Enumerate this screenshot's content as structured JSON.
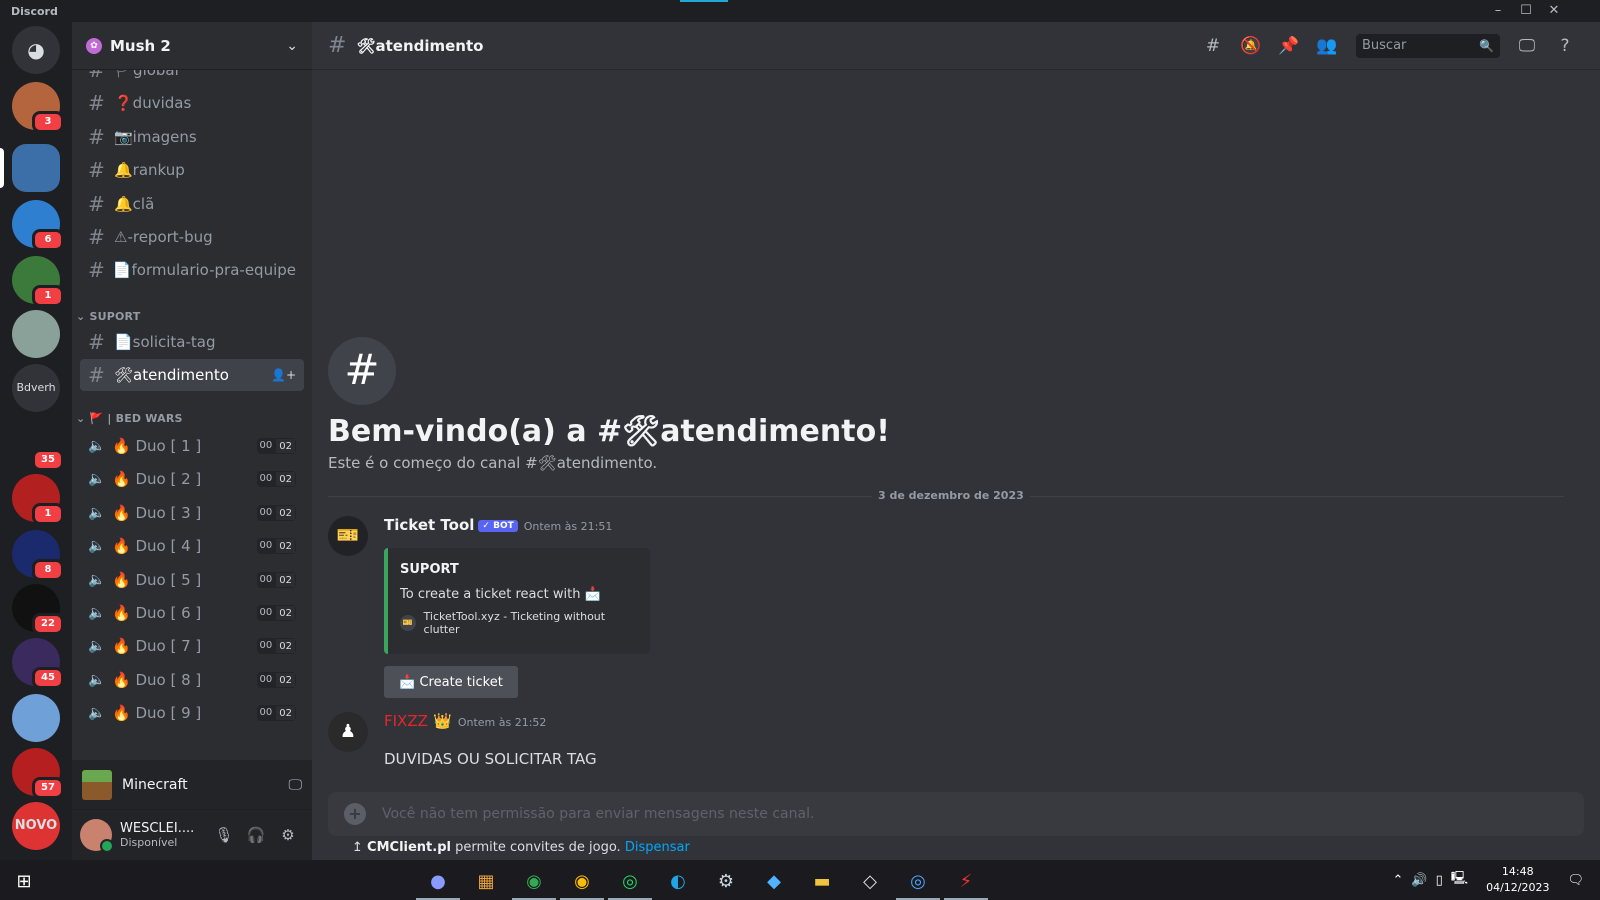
{
  "window": {
    "app_name": "Discord",
    "minimize": "–",
    "maximize": "☐",
    "close": "✕"
  },
  "servers": [
    {
      "name": "direct-messages",
      "badge": "",
      "initials": "",
      "color": "#313338"
    },
    {
      "name": "server-1",
      "badge": "3",
      "color": "#b5653e"
    },
    {
      "name": "mush",
      "badge": "",
      "color": "#3c6fa8",
      "active": true
    },
    {
      "name": "server-3",
      "badge": "6",
      "color": "#2f7fd0"
    },
    {
      "name": "server-4",
      "badge": "1",
      "color": "#3c7a3c"
    },
    {
      "name": "server-5",
      "badge": "",
      "color": "#8aa19a"
    },
    {
      "name": "bdverh",
      "badge": "",
      "initials": "Bdverh",
      "color": "#313338"
    },
    {
      "name": "server-7",
      "badge": "35",
      "color": "#1e1f22"
    },
    {
      "name": "hv",
      "badge": "1",
      "color": "#b32020"
    },
    {
      "name": "server-9",
      "badge": "8",
      "color": "#1a2a6c"
    },
    {
      "name": "server-10",
      "badge": "22",
      "color": "#111"
    },
    {
      "name": "server-11",
      "badge": "45",
      "color": "#3a2a5e"
    },
    {
      "name": "server-12",
      "badge": "",
      "color": "#6fa0d8"
    },
    {
      "name": "server-13",
      "badge": "57",
      "color": "#b51f1f"
    },
    {
      "name": "novo",
      "badge": "",
      "initials": "NOVO",
      "color": "#d33"
    }
  ],
  "guild": {
    "name": "Mush 2"
  },
  "channels_top": [
    {
      "name": "🏳global",
      "partial": true
    },
    {
      "name": "❓duvidas"
    },
    {
      "name": "📷imagens"
    },
    {
      "name": "🔔rankup"
    },
    {
      "name": "🔔clã"
    },
    {
      "name": "⚠-report-bug"
    },
    {
      "name": "📄formulario-pra-equipe"
    }
  ],
  "category_suport": "SUPORT",
  "channels_suport": [
    {
      "name": "📄solicita-tag"
    },
    {
      "name": "🛠atendimento",
      "active": true
    }
  ],
  "category_bedwars": "🚩 | BED WARS",
  "voice_channels": [
    {
      "name": "🔥 Duo [ 1 ]",
      "count": "00",
      "limit": "02"
    },
    {
      "name": "🔥 Duo [ 2 ]",
      "count": "00",
      "limit": "02"
    },
    {
      "name": "🔥 Duo [ 3 ]",
      "count": "00",
      "limit": "02"
    },
    {
      "name": "🔥 Duo [ 4 ]",
      "count": "00",
      "limit": "02"
    },
    {
      "name": "🔥 Duo [ 5 ]",
      "count": "00",
      "limit": "02"
    },
    {
      "name": "🔥 Duo [ 6 ]",
      "count": "00",
      "limit": "02"
    },
    {
      "name": "🔥 Duo [ 7 ]",
      "count": "00",
      "limit": "02"
    },
    {
      "name": "🔥 Duo [ 8 ]",
      "count": "00",
      "limit": "02"
    },
    {
      "name": "🔥 Duo [ 9 ]",
      "count": "00",
      "limit": "02"
    }
  ],
  "activity": {
    "name": "Minecraft"
  },
  "user": {
    "name": "WESCLEI....",
    "status": "Disponível"
  },
  "channel_header": {
    "name": "🛠atendimento",
    "search_placeholder": "Buscar"
  },
  "welcome": {
    "title": "Bem-vindo(a) a #🛠atendimento!",
    "subtitle": "Este é o começo do canal #🛠atendimento."
  },
  "date_divider": "3 de dezembro de 2023",
  "messages": [
    {
      "author": "Ticket Tool",
      "bot_label": "✓ BOT",
      "timestamp": "Ontem às 21:51",
      "author_color": "#f2f3f5",
      "embed": {
        "title": "SUPORT",
        "description": "To create a ticket react with 📩",
        "footer": "TicketTool.xyz - Ticketing without clutter"
      },
      "button": "📩 Create ticket"
    },
    {
      "author": "FIXZZ",
      "crown": "👑",
      "timestamp": "Ontem às 21:52",
      "author_color": "#e7262b",
      "text": "DUVIDAS OU SOLICITAR TAG"
    }
  ],
  "composer": {
    "placeholder": "Você não tem permissão para enviar mensagens neste canal."
  },
  "invite_bar": {
    "prefix": "↥",
    "app": "CMClient.pl",
    "text": "permite convites de jogo.",
    "action": "Dispensar"
  },
  "taskbar": {
    "time": "14:48",
    "date": "04/12/2023"
  }
}
